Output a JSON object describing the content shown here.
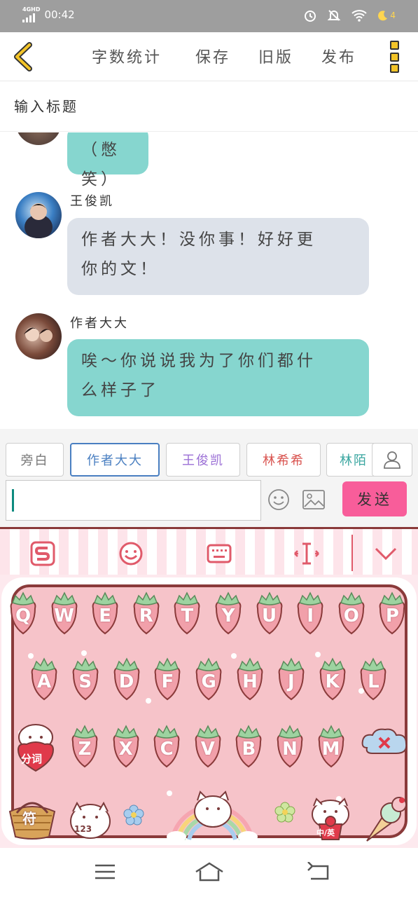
{
  "status_bar": {
    "network": "4GHD",
    "time": "00:42",
    "battery": "4"
  },
  "toolbar": {
    "word_count": "字数统计",
    "save": "保存",
    "old_version": "旧版",
    "publish": "发布"
  },
  "title_placeholder": "输入标题",
  "messages": [
    {
      "sender": "",
      "text": "（憋笑）",
      "style": "green"
    },
    {
      "sender": "王俊凯",
      "text_lines": [
        "作者大大！没你事！好好更",
        "你的文！"
      ],
      "style": "gray"
    },
    {
      "sender": "作者大大",
      "text_lines": [
        "唉～你说说我为了你们都什",
        "么样子了"
      ],
      "style": "green"
    }
  ],
  "roles": [
    {
      "label": "旁白",
      "color": "#777777"
    },
    {
      "label": "作者大大",
      "color": "#4a7fc1"
    },
    {
      "label": "王俊凯",
      "color": "#9b6fd6"
    },
    {
      "label": "林希希",
      "color": "#d9534f"
    },
    {
      "label": "林陌",
      "color": "#3aa6a0"
    }
  ],
  "input": {
    "value": "",
    "send": "发送"
  },
  "keyboard": {
    "row1": [
      "Q",
      "W",
      "E",
      "R",
      "T",
      "Y",
      "U",
      "I",
      "O",
      "P"
    ],
    "row2": [
      "A",
      "S",
      "D",
      "F",
      "G",
      "H",
      "J",
      "K",
      "L"
    ],
    "row3": [
      "Z",
      "X",
      "C",
      "V",
      "B",
      "N",
      "M"
    ],
    "fenci": "分词",
    "symbol": "符",
    "num": "123",
    "lang": "中/英"
  }
}
